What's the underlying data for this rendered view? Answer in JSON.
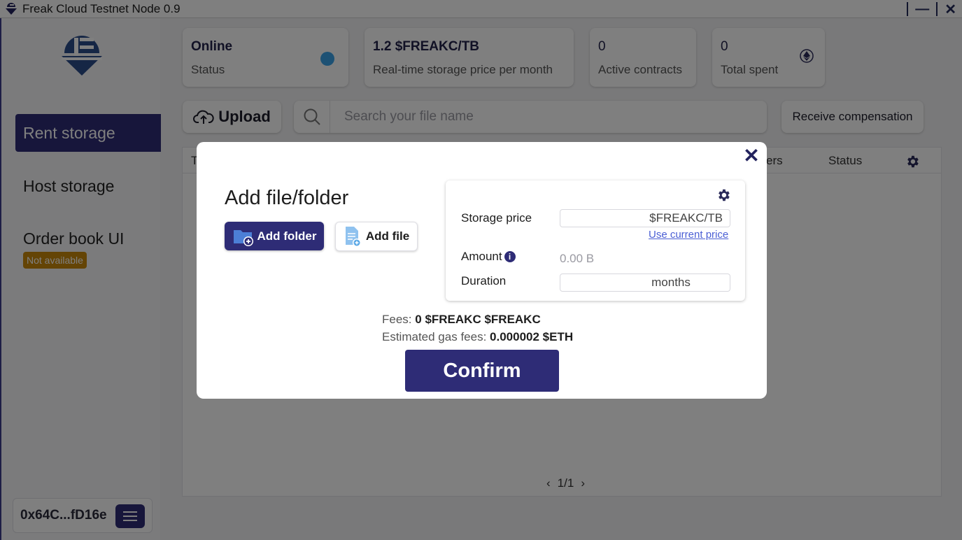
{
  "window": {
    "title": "Freak Cloud Testnet Node 0.9",
    "controls": {
      "minimize": "—",
      "close": "✕"
    }
  },
  "sidebar": {
    "items": [
      {
        "label": "Rent storage",
        "active": true
      },
      {
        "label": "Host storage",
        "active": false
      },
      {
        "label": "Order book UI",
        "active": false
      }
    ],
    "order_book_badge": "Not available",
    "wallet_address": "0x64C...fD16e"
  },
  "stats": {
    "status": {
      "value": "Online",
      "label": "Status"
    },
    "price": {
      "value": "1.2 $FREAKC/TB",
      "label": "Real-time storage price per month"
    },
    "contracts": {
      "value": "0",
      "label": "Active contracts"
    },
    "spent": {
      "value": "0",
      "label": "Total spent"
    }
  },
  "toolbar": {
    "upload_label": "Upload",
    "search_placeholder": "Search your file name",
    "receive_label": "Receive compensation"
  },
  "table": {
    "headers": {
      "first": "T",
      "hosts_fragment": "ers",
      "status": "Status"
    },
    "pager": "1/1"
  },
  "modal": {
    "title": "Add file/folder",
    "add_folder_label": "Add folder",
    "add_file_label": "Add file",
    "storage_price_label": "Storage price",
    "storage_price_unit": "$FREAKC/TB",
    "use_current_price": "Use current price",
    "amount_label": "Amount",
    "amount_value": "0.00 B",
    "duration_label": "Duration",
    "duration_unit": "months",
    "fees_label": "Fees:",
    "fees_value": "0 $FREAKC $FREAKC",
    "gas_label": "Estimated gas fees:",
    "gas_value": "0.000002 $ETH",
    "confirm_label": "Confirm"
  },
  "colors": {
    "brand": "#2e2c76",
    "status_online": "#3aa3e8",
    "badge": "#c8880b",
    "link": "#4b5fd4"
  }
}
